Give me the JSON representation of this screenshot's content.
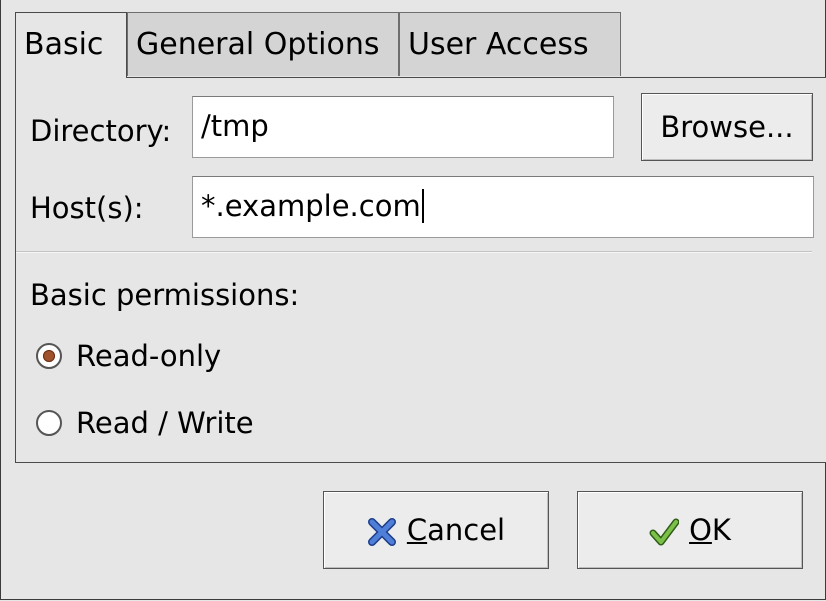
{
  "tabs": [
    {
      "label": "Basic",
      "active": true
    },
    {
      "label": "General Options",
      "active": false
    },
    {
      "label": "User Access",
      "active": false
    }
  ],
  "form": {
    "directory_label": "Directory:",
    "directory_value": "/tmp",
    "browse_label": "Browse...",
    "hosts_label": "Host(s):",
    "hosts_value": "*.example.com"
  },
  "permissions": {
    "heading": "Basic permissions:",
    "options": [
      {
        "label": "Read-only",
        "selected": true
      },
      {
        "label": "Read / Write",
        "selected": false
      }
    ]
  },
  "buttons": {
    "cancel_mnemonic": "C",
    "cancel_rest": "ancel",
    "ok_mnemonic": "O",
    "ok_rest": "K"
  },
  "icons": {
    "cancel": "blue-x-icon",
    "ok": "green-checkmark-icon"
  },
  "colors": {
    "radio_selected": "#a0522d",
    "cancel_icon": "#2f5fbf",
    "ok_icon": "#4e9a2e"
  }
}
